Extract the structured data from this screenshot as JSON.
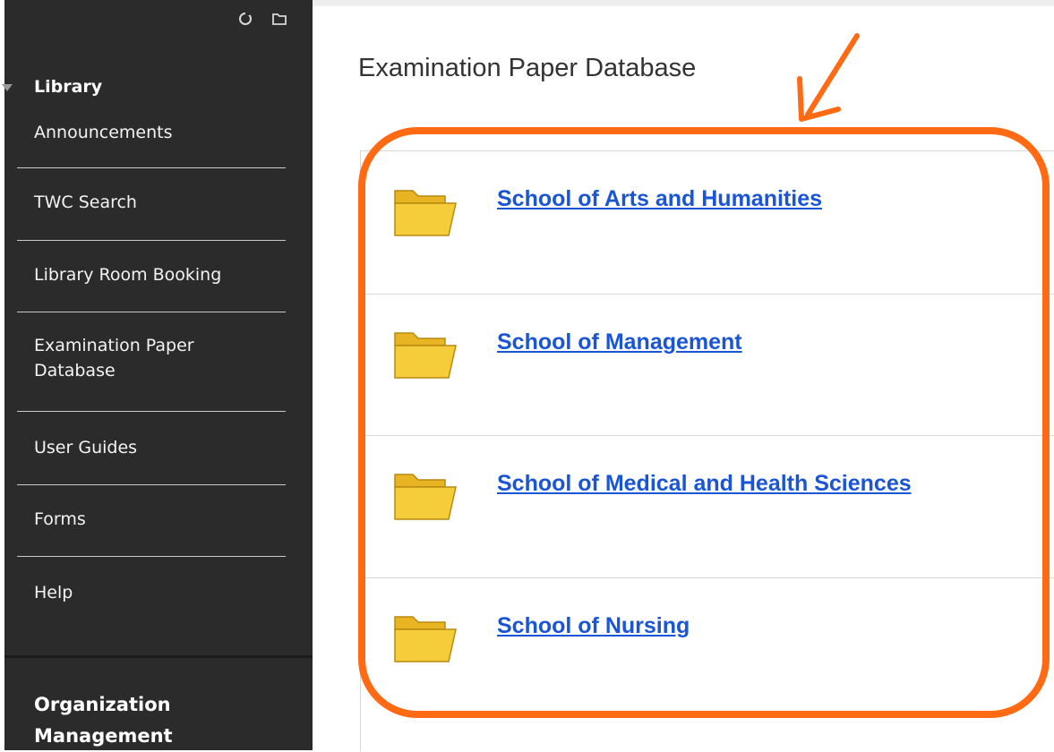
{
  "sidebar": {
    "course_title": "Library",
    "items": [
      {
        "label": "Announcements"
      },
      {
        "label": "TWC Search"
      },
      {
        "label": "Library Room Booking"
      },
      {
        "label": "Examination Paper Database"
      },
      {
        "label": "User Guides"
      },
      {
        "label": "Forms"
      },
      {
        "label": "Help"
      }
    ],
    "section_title": "Organization Management",
    "tool_icons": [
      "refresh-icon",
      "folder-view-icon"
    ]
  },
  "main": {
    "title": "Examination Paper Database",
    "folders": [
      {
        "label": "School of Arts and Humanities",
        "icon": "folder-icon"
      },
      {
        "label": "School of Management",
        "icon": "folder-icon"
      },
      {
        "label": "School of Medical and Health Sciences",
        "icon": "folder-icon"
      },
      {
        "label": "School of Nursing",
        "icon": "folder-icon"
      }
    ]
  },
  "colors": {
    "sidebar_bg": "#2b2b2b",
    "link": "#1a55d6",
    "annotation": "#ff6a13",
    "folder": "#f2c230"
  }
}
